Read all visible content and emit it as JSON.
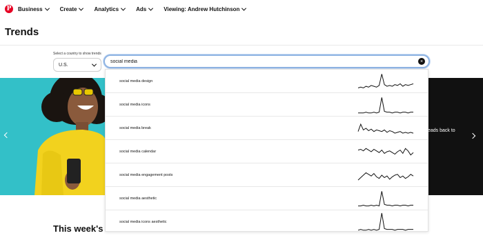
{
  "nav": {
    "logo_letter": "P",
    "items": [
      {
        "label": "Business"
      },
      {
        "label": "Create"
      },
      {
        "label": "Analytics"
      },
      {
        "label": "Ads"
      },
      {
        "label": "Viewing: Andrew Hutchinson"
      }
    ]
  },
  "page": {
    "title": "Trends"
  },
  "country": {
    "label": "Select a country to show trends",
    "value": "U.S."
  },
  "search": {
    "value": "social media",
    "clear_icon": "×"
  },
  "hero": {
    "right_text": "eads back to"
  },
  "section": {
    "title": "This week's to"
  },
  "colors": {
    "brand": "#e60023",
    "hero_teal": "#33c0c8",
    "hero_dark": "#111111",
    "focus": "#8fb4e3"
  },
  "suggestions": [
    {
      "label": "social media design",
      "trend": [
        3,
        4,
        3,
        5,
        4,
        6,
        5,
        4,
        6,
        20,
        7,
        5,
        6,
        5,
        7,
        6,
        8,
        5,
        7,
        6,
        7,
        8
      ]
    },
    {
      "label": "social media icons",
      "trend": [
        1,
        1,
        1,
        2,
        1,
        1,
        2,
        1,
        2,
        20,
        3,
        2,
        2,
        1,
        2,
        2,
        1,
        2,
        2,
        1,
        2,
        2
      ]
    },
    {
      "label": "social media break",
      "trend": [
        7,
        16,
        9,
        11,
        8,
        10,
        7,
        9,
        8,
        7,
        9,
        6,
        8,
        7,
        5,
        6,
        7,
        5,
        6,
        5,
        6,
        5
      ]
    },
    {
      "label": "social media calendar",
      "trend": [
        13,
        14,
        12,
        15,
        13,
        11,
        14,
        12,
        10,
        13,
        9,
        11,
        12,
        10,
        8,
        11,
        13,
        9,
        15,
        12,
        7,
        10
      ]
    },
    {
      "label": "social media engagement posts",
      "trend": [
        5,
        8,
        11,
        14,
        12,
        10,
        13,
        9,
        7,
        11,
        8,
        10,
        6,
        9,
        11,
        12,
        8,
        10,
        7,
        9,
        12,
        10
      ]
    },
    {
      "label": "social media aesthetic",
      "trend": [
        2,
        2,
        3,
        2,
        2,
        3,
        2,
        3,
        2,
        20,
        4,
        3,
        3,
        2,
        3,
        3,
        2,
        3,
        3,
        2,
        3,
        3
      ]
    },
    {
      "label": "social media icons aesthetic",
      "trend": [
        1,
        2,
        1,
        1,
        2,
        1,
        2,
        1,
        2,
        22,
        3,
        2,
        2,
        2,
        1,
        2,
        2,
        2,
        1,
        2,
        2,
        2
      ]
    }
  ]
}
